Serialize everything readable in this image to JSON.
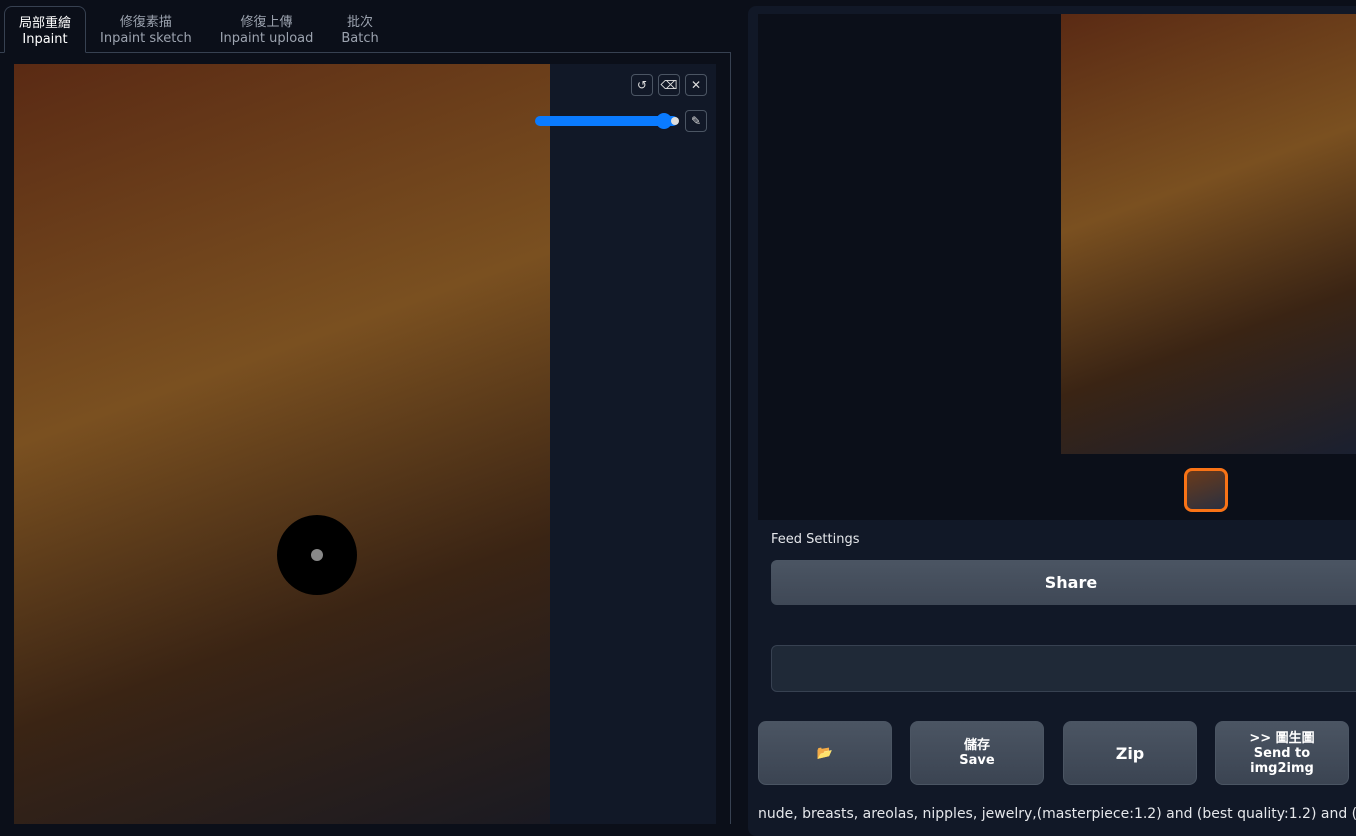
{
  "tabs": [
    {
      "zh": "局部重繪",
      "en": "Inpaint"
    },
    {
      "zh": "修復素描",
      "en": "Inpaint sketch"
    },
    {
      "zh": "修復上傳",
      "en": "Inpaint upload"
    },
    {
      "zh": "批次",
      "en": "Batch"
    }
  ],
  "canvas": {
    "tools": {
      "undo": "↺",
      "erase": "⌫",
      "clear": "✕",
      "brush": "✎"
    },
    "brush_size_percent": 95
  },
  "feed_settings_label": "Feed Settings",
  "share_label": "Share",
  "buttons": {
    "folder": "📂",
    "save_zh": "儲存",
    "save_en": "Save",
    "zip": "Zip",
    "send_zh": ">> 圖生圖",
    "send_en1": "Send to",
    "send_en2": "img2img"
  },
  "prompt_text": "nude, breasts, areolas, nipples, jewelry,(masterpiece:1.2) and (best quality:1.2) and (photore"
}
